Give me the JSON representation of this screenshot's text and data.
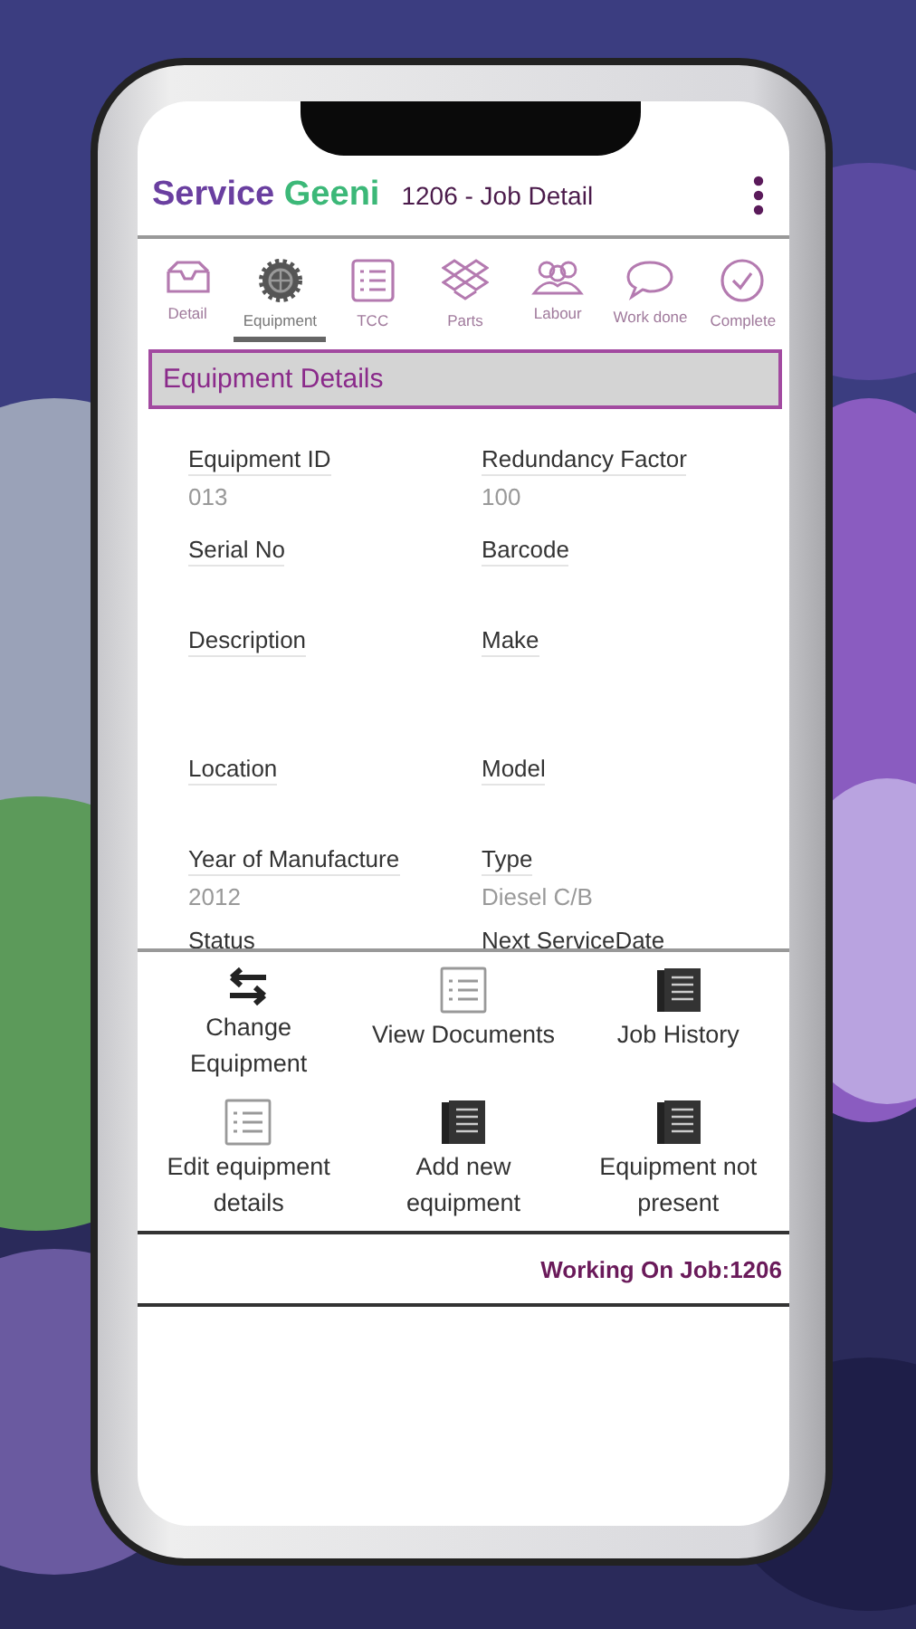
{
  "app_bar": {
    "logo": {
      "first": "Service",
      "second": "Geeni"
    },
    "title": "1206 - Job Detail"
  },
  "tabs": [
    {
      "label": "Detail",
      "selected": false
    },
    {
      "label": "Equipment",
      "selected": true
    },
    {
      "label": "TCC",
      "selected": false
    },
    {
      "label": "Parts",
      "selected": false
    },
    {
      "label": "Labour",
      "selected": false
    },
    {
      "label": "Work done",
      "selected": false
    },
    {
      "label": "Complete",
      "selected": false
    }
  ],
  "section": {
    "title": "Equipment Details"
  },
  "fields": [
    {
      "label": "Equipment ID",
      "value": "013"
    },
    {
      "label": "Redundancy Factor",
      "value": "100"
    },
    {
      "label": "Serial No"
    },
    {
      "label": "Barcode"
    },
    {
      "label": "Description"
    },
    {
      "label": "Make"
    },
    {
      "label": "Location"
    },
    {
      "label": "Model"
    },
    {
      "label": "Year of Manufacture",
      "value": "2012"
    },
    {
      "label": "Type",
      "value": "Diesel C/B"
    },
    {
      "label": "Status"
    },
    {
      "label": "Next ServiceDate"
    }
  ],
  "actions": [
    {
      "label": "Change Equipment"
    },
    {
      "label": "View Documents"
    },
    {
      "label": "Job History"
    },
    {
      "label": "Edit equipment details"
    },
    {
      "label": "Add new equipment"
    },
    {
      "label": "Equipment not present"
    }
  ],
  "status_bar": {
    "text": "Working On Job:1206"
  }
}
